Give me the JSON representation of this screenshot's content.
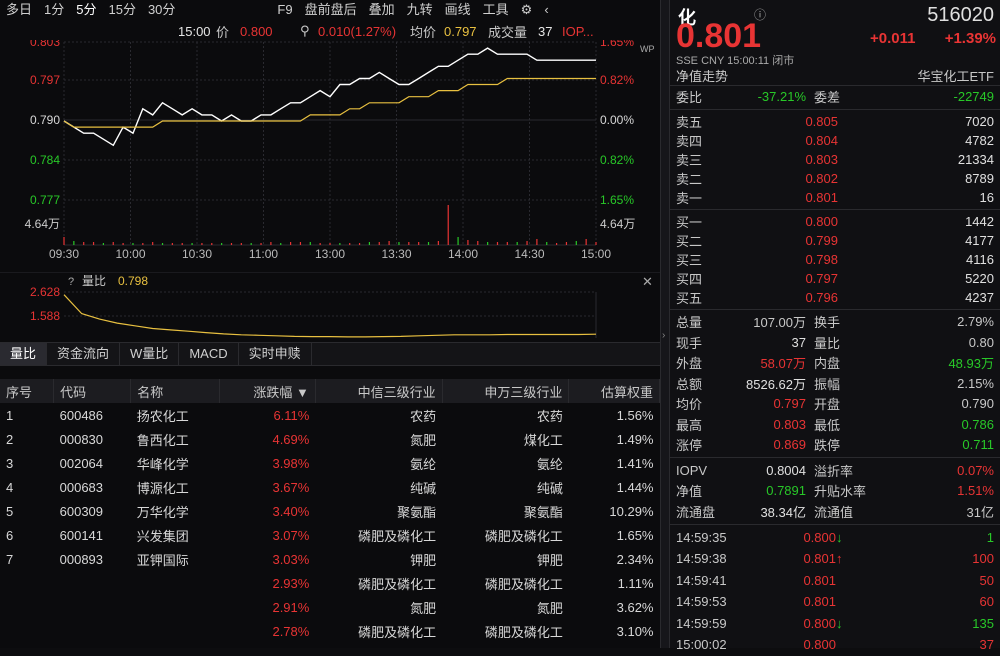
{
  "toolbar": {
    "items": [
      "多日",
      "1分",
      "5分",
      "15分",
      "30分",
      "F9",
      "盘前盘后",
      "叠加",
      "九转",
      "画线",
      "工具"
    ],
    "active": "5分"
  },
  "info": {
    "time": "15:00",
    "price_label": "价",
    "price": "0.800",
    "change": "0.010(1.27%)",
    "avg_label": "均价",
    "avg": "0.797",
    "vol_label": "成交量",
    "vol": "37",
    "iopv": "IOP..."
  },
  "chart_data": [
    {
      "type": "line",
      "title": "",
      "xlabel": "",
      "ylabel": "",
      "x_ticks": [
        "09:30",
        "10:00",
        "10:30",
        "11:00",
        "13:00",
        "13:30",
        "14:00",
        "14:30",
        "15:00"
      ],
      "y_left_ticks": [
        "0.803",
        "0.797",
        "0.790",
        "0.784",
        "0.777"
      ],
      "y_right_ticks": [
        "1.65%",
        "0.82%",
        "0.00%",
        "0.82%",
        "1.65%"
      ],
      "ylim": [
        0.777,
        0.803
      ],
      "volume_label": "4.64万",
      "series": [
        {
          "values": [
            0.79,
            0.789,
            0.788,
            0.788,
            0.787,
            0.786,
            0.789,
            0.788,
            0.792,
            0.791,
            0.793,
            0.792,
            0.791,
            0.792,
            0.791,
            0.791,
            0.79,
            0.791,
            0.79,
            0.79,
            0.791,
            0.791,
            0.792,
            0.793,
            0.793,
            0.794,
            0.795,
            0.794,
            0.796,
            0.796,
            0.797,
            0.797,
            0.798,
            0.797,
            0.796,
            0.796,
            0.797,
            0.798,
            0.799,
            0.799,
            0.8,
            0.801,
            0.801,
            0.802,
            0.801,
            0.801,
            0.801,
            0.801,
            0.8,
            0.8,
            0.8,
            0.8,
            0.8,
            0.8,
            0.8
          ]
        },
        {
          "values": [
            0.79,
            0.789,
            0.789,
            0.789,
            0.789,
            0.789,
            0.789,
            0.789,
            0.789,
            0.789,
            0.79,
            0.79,
            0.79,
            0.79,
            0.79,
            0.79,
            0.79,
            0.79,
            0.79,
            0.79,
            0.79,
            0.79,
            0.79,
            0.79,
            0.79,
            0.791,
            0.791,
            0.791,
            0.791,
            0.792,
            0.792,
            0.793,
            0.793,
            0.793,
            0.793,
            0.794,
            0.794,
            0.794,
            0.795,
            0.795,
            0.795,
            0.796,
            0.796,
            0.796,
            0.796,
            0.797,
            0.797,
            0.797,
            0.797,
            0.797,
            0.797,
            0.797,
            0.797,
            0.797,
            0.797
          ]
        }
      ]
    },
    {
      "type": "line",
      "title": "",
      "legend_label": "量比",
      "value": "0.798",
      "y_ticks": [
        "2.628",
        "1.588"
      ],
      "series": [
        {
          "values": [
            2.6,
            1.9,
            1.7,
            1.55,
            1.45,
            1.35,
            1.3,
            1.25,
            1.2,
            1.15,
            1.12,
            1.1,
            1.08,
            1.06,
            1.05,
            1.05,
            1.04,
            1.04,
            1.05,
            1.06,
            1.08,
            1.1,
            1.12,
            1.12,
            1.12,
            1.13,
            1.13,
            1.13,
            1.13,
            1.13,
            1.14
          ]
        }
      ]
    }
  ],
  "tabs": [
    "量比",
    "资金流向",
    "W量比",
    "MACD",
    "实时申赎"
  ],
  "table": {
    "headers": [
      "序号",
      "代码",
      "名称",
      "涨跌幅 ▼",
      "中信三级行业",
      "申万三级行业",
      "估算权重"
    ],
    "rows": [
      [
        "1",
        "600486",
        "扬农化工",
        "6.11%",
        "农药",
        "农药",
        "1.56%"
      ],
      [
        "2",
        "000830",
        "鲁西化工",
        "4.69%",
        "氮肥",
        "煤化工",
        "1.49%"
      ],
      [
        "3",
        "002064",
        "华峰化学",
        "3.98%",
        "氨纶",
        "氨纶",
        "1.41%"
      ],
      [
        "4",
        "000683",
        "博源化工",
        "3.67%",
        "纯碱",
        "纯碱",
        "1.44%"
      ],
      [
        "5",
        "600309",
        "万华化学",
        "3.40%",
        "聚氨酯",
        "聚氨酯",
        "10.29%"
      ],
      [
        "6",
        "600141",
        "兴发集团",
        "3.07%",
        "磷肥及磷化工",
        "磷肥及磷化工",
        "1.65%"
      ],
      [
        "7",
        "000893",
        "亚钾国际",
        "3.03%",
        "钾肥",
        "钾肥",
        "2.34%"
      ],
      [
        "",
        "",
        "",
        "2.93%",
        "磷肥及磷化工",
        "磷肥及磷化工",
        "1.11%"
      ],
      [
        "",
        "",
        "",
        "2.91%",
        "氮肥",
        "氮肥",
        "3.62%"
      ],
      [
        "",
        "",
        "",
        "2.78%",
        "磷肥及磷化工",
        "磷肥及磷化工",
        "3.10%"
      ]
    ]
  },
  "quote": {
    "name": "化",
    "code": "516020",
    "price": "0.801",
    "chg": "+0.011",
    "pct": "+1.39%",
    "market": "SSE  CNY  15:00:11  闭市",
    "nav_label": "净值走势",
    "fund_name": "华宝化工ETF",
    "weibi_label": "委比",
    "weibi": "-37.21%",
    "weicha_label": "委差",
    "weicha": "-22749",
    "asks": [
      [
        "卖五",
        "0.805",
        "7020"
      ],
      [
        "卖四",
        "0.804",
        "4782"
      ],
      [
        "卖三",
        "0.803",
        "21334"
      ],
      [
        "卖二",
        "0.802",
        "8789"
      ],
      [
        "卖一",
        "0.801",
        "16"
      ]
    ],
    "bids": [
      [
        "买一",
        "0.800",
        "1442"
      ],
      [
        "买二",
        "0.799",
        "4177"
      ],
      [
        "买三",
        "0.798",
        "4116"
      ],
      [
        "买四",
        "0.797",
        "5220"
      ],
      [
        "买五",
        "0.796",
        "4237"
      ]
    ],
    "stats": [
      [
        "总量",
        "107.00万",
        "换手",
        "2.79%"
      ],
      [
        "现手",
        "37",
        "量比",
        "0.80"
      ],
      [
        "外盘",
        "58.07万",
        "内盘",
        "48.93万"
      ],
      [
        "总额",
        "8526.62万",
        "振幅",
        "2.15%"
      ],
      [
        "均价",
        "0.797",
        "开盘",
        "0.790"
      ],
      [
        "最高",
        "0.803",
        "最低",
        "0.786"
      ],
      [
        "涨停",
        "0.869",
        "跌停",
        "0.711"
      ]
    ],
    "stats2": [
      [
        "IOPV",
        "0.8004",
        "溢折率",
        "0.07%"
      ],
      [
        "净值",
        "0.7891",
        "升贴水率",
        "1.51%"
      ],
      [
        "流通盘",
        "38.34亿",
        "流通值",
        "31亿"
      ]
    ],
    "ticks": [
      [
        "14:59:35",
        "0.800",
        "↓",
        "1"
      ],
      [
        "14:59:38",
        "0.801",
        "↑",
        "100"
      ],
      [
        "14:59:41",
        "0.801",
        "",
        "50"
      ],
      [
        "14:59:53",
        "0.801",
        "",
        "60"
      ],
      [
        "14:59:59",
        "0.800",
        "↓",
        "135"
      ],
      [
        "15:00:02",
        "0.800",
        "",
        "37"
      ]
    ]
  }
}
